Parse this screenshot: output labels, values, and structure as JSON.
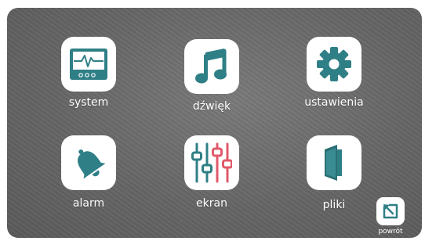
{
  "colors": {
    "icon": "#2f7f86",
    "background": "#6b6b6b",
    "tile": "#ffffff",
    "text": "#ffffff"
  },
  "menu": {
    "system": {
      "label": "system",
      "icon": "monitor-pulse-icon"
    },
    "sound": {
      "label": "dźwięk",
      "icon": "music-note-icon"
    },
    "settings": {
      "label": "ustawienia",
      "icon": "gear-icon"
    },
    "alarm": {
      "label": "alarm",
      "icon": "bell-icon"
    },
    "screen": {
      "label": "ekran",
      "icon": "sliders-icon"
    },
    "files": {
      "label": "pliki",
      "icon": "folder-icon"
    }
  },
  "back": {
    "label": "powrót",
    "icon": "return-arrow-icon"
  }
}
